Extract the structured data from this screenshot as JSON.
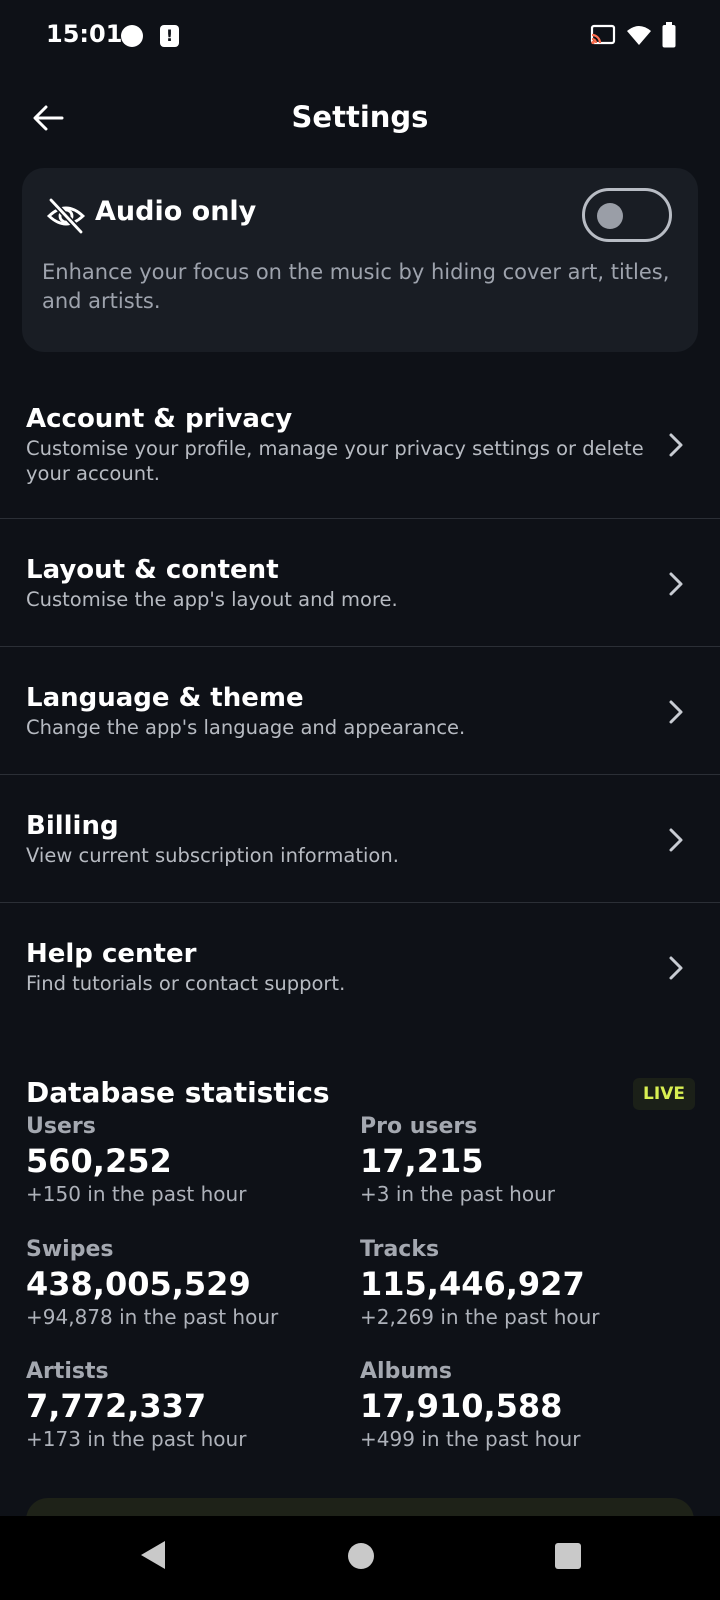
{
  "status_bar": {
    "time": "15:01",
    "alert_glyph": "!",
    "icons": [
      "cast-icon",
      "wifi-icon",
      "battery-icon"
    ]
  },
  "header": {
    "title": "Settings",
    "back_icon": "arrow-left-icon"
  },
  "audio_only": {
    "title": "Audio only",
    "description": "Enhance your focus on the music by hiding cover art, titles, and artists.",
    "enabled": false,
    "icon": "eye-off-icon"
  },
  "settings_items": [
    {
      "title": "Account & privacy",
      "description": "Customise your profile, manage your privacy settings or delete your account."
    },
    {
      "title": "Layout & content",
      "description": "Customise the app's layout and more."
    },
    {
      "title": "Language & theme",
      "description": "Change the app's language and appearance."
    },
    {
      "title": "Billing",
      "description": "View current subscription information."
    },
    {
      "title": "Help center",
      "description": "Find tutorials or contact support."
    }
  ],
  "stats": {
    "title": "Database statistics",
    "badge": "LIVE",
    "items": [
      {
        "label": "Users",
        "value": "560,252",
        "delta": "+150 in the past hour"
      },
      {
        "label": "Pro users",
        "value": "17,215",
        "delta": "+3 in the past hour"
      },
      {
        "label": "Swipes",
        "value": "438,005,529",
        "delta": "+94,878 in the past hour"
      },
      {
        "label": "Tracks",
        "value": "115,446,927",
        "delta": "+2,269 in the past hour"
      },
      {
        "label": "Artists",
        "value": "7,772,337",
        "delta": "+173 in the past hour"
      },
      {
        "label": "Albums",
        "value": "17,910,588",
        "delta": "+499 in the past hour"
      }
    ]
  },
  "colors": {
    "background": "#0e1117",
    "card": "#191d24",
    "live_accent": "#d8ef52"
  }
}
